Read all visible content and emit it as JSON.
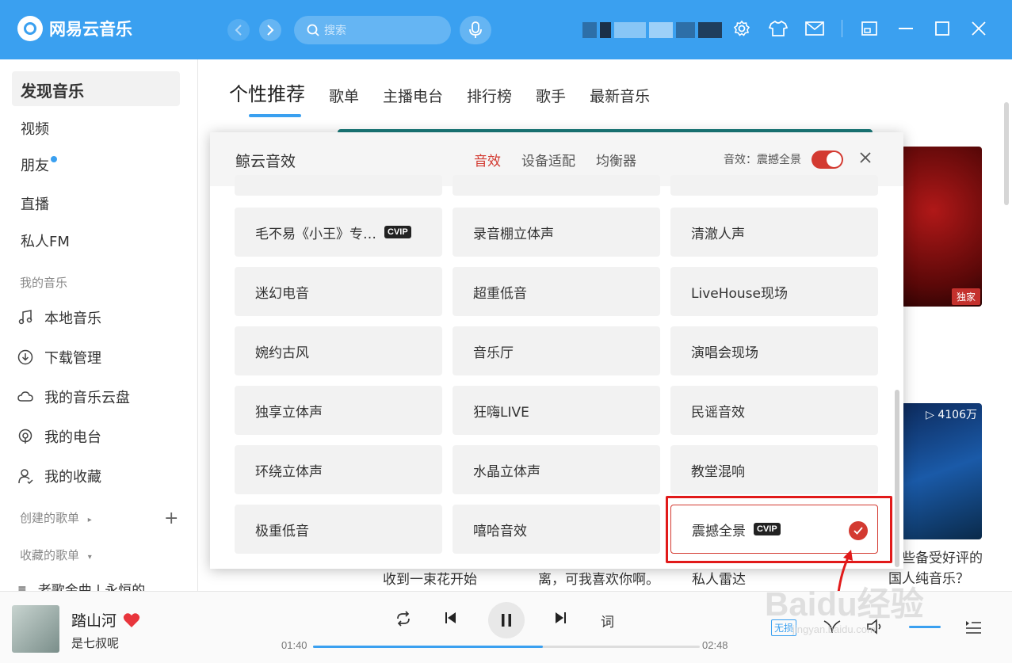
{
  "app": {
    "title": "网易云音乐"
  },
  "search": {
    "placeholder": "搜索"
  },
  "sidebar": {
    "top": [
      {
        "label": "发现音乐"
      },
      {
        "label": "视频"
      },
      {
        "label": "朋友"
      },
      {
        "label": "直播"
      },
      {
        "label": "私人FM"
      }
    ],
    "my_music_title": "我的音乐",
    "my_music": [
      {
        "label": "本地音乐",
        "icon": "music-note-icon"
      },
      {
        "label": "下载管理",
        "icon": "download-icon"
      },
      {
        "label": "我的音乐云盘",
        "icon": "cloud-icon"
      },
      {
        "label": "我的电台",
        "icon": "radio-icon"
      },
      {
        "label": "我的收藏",
        "icon": "user-icon"
      }
    ],
    "created_title": "创建的歌单",
    "collected_title": "收藏的歌单",
    "playlist_item": "老歌金曲 | 永恒的"
  },
  "main": {
    "tabs": [
      "个性推荐",
      "歌单",
      "主播电台",
      "排行榜",
      "歌手",
      "最新音乐"
    ],
    "badge_exclusive": "独家",
    "play_count": "▷ 4106万",
    "below_texts": [
      "收到一束花开始",
      "离，可我喜欢你啊。",
      "私人雷达"
    ],
    "below_right": "哪些备受好评的国人纯音乐？"
  },
  "dialog": {
    "title": "鲸云音效",
    "tabs": [
      "音效",
      "设备适配",
      "均衡器"
    ],
    "status": "音效：震撼全景",
    "effects": [
      {
        "label": "毛不易《小王》专…",
        "vip": true
      },
      {
        "label": "录音棚立体声",
        "vip": false
      },
      {
        "label": "清澈人声",
        "vip": false
      },
      {
        "label": "迷幻电音",
        "vip": false
      },
      {
        "label": "超重低音",
        "vip": false
      },
      {
        "label": "LiveHouse现场",
        "vip": false
      },
      {
        "label": "婉约古风",
        "vip": false
      },
      {
        "label": "音乐厅",
        "vip": false
      },
      {
        "label": "演唱会现场",
        "vip": false
      },
      {
        "label": "独享立体声",
        "vip": false
      },
      {
        "label": "狂嗨LIVE",
        "vip": false
      },
      {
        "label": "民谣音效",
        "vip": false
      },
      {
        "label": "环绕立体声",
        "vip": false
      },
      {
        "label": "水晶立体声",
        "vip": false
      },
      {
        "label": "教堂混响",
        "vip": false
      },
      {
        "label": "极重低音",
        "vip": false
      },
      {
        "label": "嘻哈音效",
        "vip": false
      },
      {
        "label": "震撼全景",
        "vip": true,
        "selected": true
      }
    ],
    "vip_label": "CVIP"
  },
  "player": {
    "song": "踏山河",
    "artist": "是七叔呢",
    "current_time": "01:40",
    "total_time": "02:48",
    "progress": 0.595,
    "lyric_label": "词",
    "quality_label": "无损"
  },
  "watermark": {
    "text": "Baidu经验",
    "sub": "jingyan.baidu.com"
  },
  "colors": {
    "brand": "#3aa0f0",
    "accent_red": "#d33a31"
  }
}
